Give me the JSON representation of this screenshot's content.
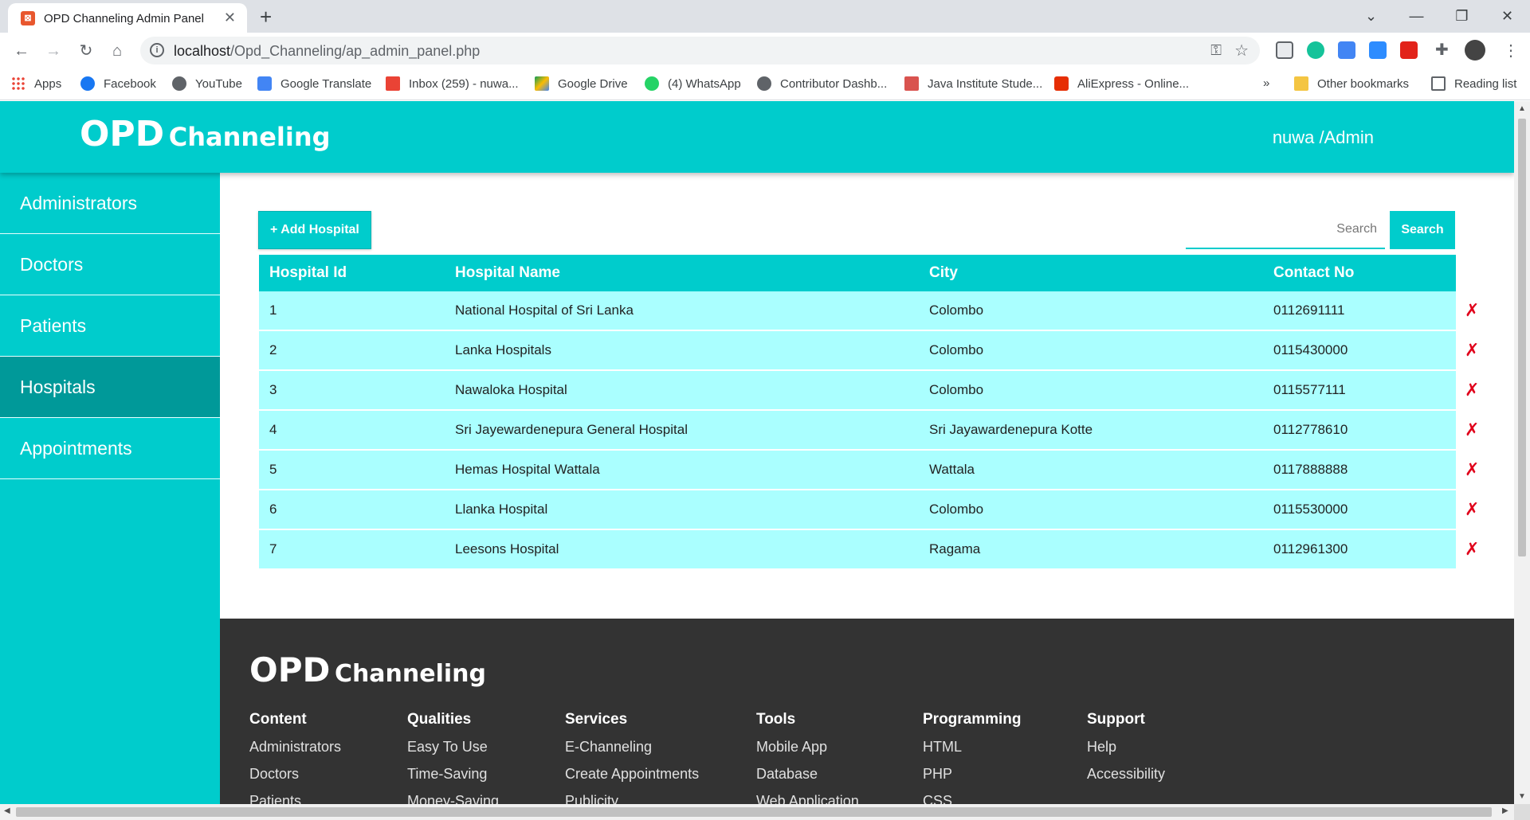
{
  "browser": {
    "tab_title": "OPD Channeling Admin Panel",
    "url_host": "localhost",
    "url_path": "/Opd_Channeling/ap_admin_panel.php",
    "bookmarks": [
      {
        "label": "Apps",
        "icon": "apps-grid-icon"
      },
      {
        "label": "Facebook",
        "icon": "facebook-icon"
      },
      {
        "label": "YouTube",
        "icon": "globe-icon"
      },
      {
        "label": "Google Translate",
        "icon": "google-translate-icon"
      },
      {
        "label": "Inbox (259) - nuwa...",
        "icon": "gmail-icon"
      },
      {
        "label": "Google Drive",
        "icon": "google-drive-icon"
      },
      {
        "label": "(4) WhatsApp",
        "icon": "whatsapp-icon"
      },
      {
        "label": "Contributor Dashb...",
        "icon": "globe-icon"
      },
      {
        "label": "Java Institute Stude...",
        "icon": "java-institute-icon"
      },
      {
        "label": "AliExpress - Online...",
        "icon": "aliexpress-icon"
      }
    ],
    "overflow_label": "»",
    "other_bookmarks": "Other bookmarks",
    "reading_list": "Reading list"
  },
  "header": {
    "brand_big": "OPD",
    "brand_small": "Channeling",
    "user": "nuwa /Admin"
  },
  "sidebar": {
    "items": [
      {
        "label": "Administrators"
      },
      {
        "label": "Doctors"
      },
      {
        "label": "Patients"
      },
      {
        "label": "Hospitals",
        "active": true
      },
      {
        "label": "Appointments"
      }
    ]
  },
  "main": {
    "add_button": "+ Add Hospital",
    "search_placeholder": "Search",
    "search_button": "Search",
    "columns": [
      "Hospital Id",
      "Hospital Name",
      "City",
      "Contact No"
    ],
    "delete_symbol": "✗",
    "rows": [
      {
        "id": "1",
        "name": "National Hospital of Sri Lanka",
        "city": "Colombo",
        "contact": "0112691111"
      },
      {
        "id": "2",
        "name": "Lanka Hospitals",
        "city": "Colombo",
        "contact": "0115430000"
      },
      {
        "id": "3",
        "name": "Nawaloka Hospital",
        "city": "Colombo",
        "contact": "0115577111"
      },
      {
        "id": "4",
        "name": "Sri Jayewardenepura General Hospital",
        "city": "Sri Jayawardenepura Kotte",
        "contact": "0112778610"
      },
      {
        "id": "5",
        "name": "Hemas Hospital Wattala",
        "city": "Wattala",
        "contact": "0117888888"
      },
      {
        "id": "6",
        "name": "Llanka Hospital",
        "city": "Colombo",
        "contact": "0115530000"
      },
      {
        "id": "7",
        "name": "Leesons Hospital",
        "city": "Ragama",
        "contact": "0112961300"
      }
    ]
  },
  "footer": {
    "brand_big": "OPD",
    "brand_small": "Channeling",
    "columns": [
      {
        "title": "Content",
        "links": [
          "Administrators",
          "Doctors",
          "Patients"
        ]
      },
      {
        "title": "Qualities",
        "links": [
          "Easy To Use",
          "Time-Saving",
          "Money-Saving"
        ]
      },
      {
        "title": "Services",
        "links": [
          "E-Channeling",
          "Create Appointments",
          "Publicity"
        ]
      },
      {
        "title": "Tools",
        "links": [
          "Mobile App",
          "Database",
          "Web Application"
        ]
      },
      {
        "title": "Programming",
        "links": [
          "HTML",
          "PHP",
          "CSS"
        ]
      },
      {
        "title": "Support",
        "links": [
          "Help",
          "Accessibility"
        ]
      }
    ]
  },
  "colors": {
    "accent": "#00cccc",
    "accent_dark": "#009999",
    "row_bg": "#aaffff",
    "footer_bg": "#333333",
    "delete": "#e0001a"
  }
}
